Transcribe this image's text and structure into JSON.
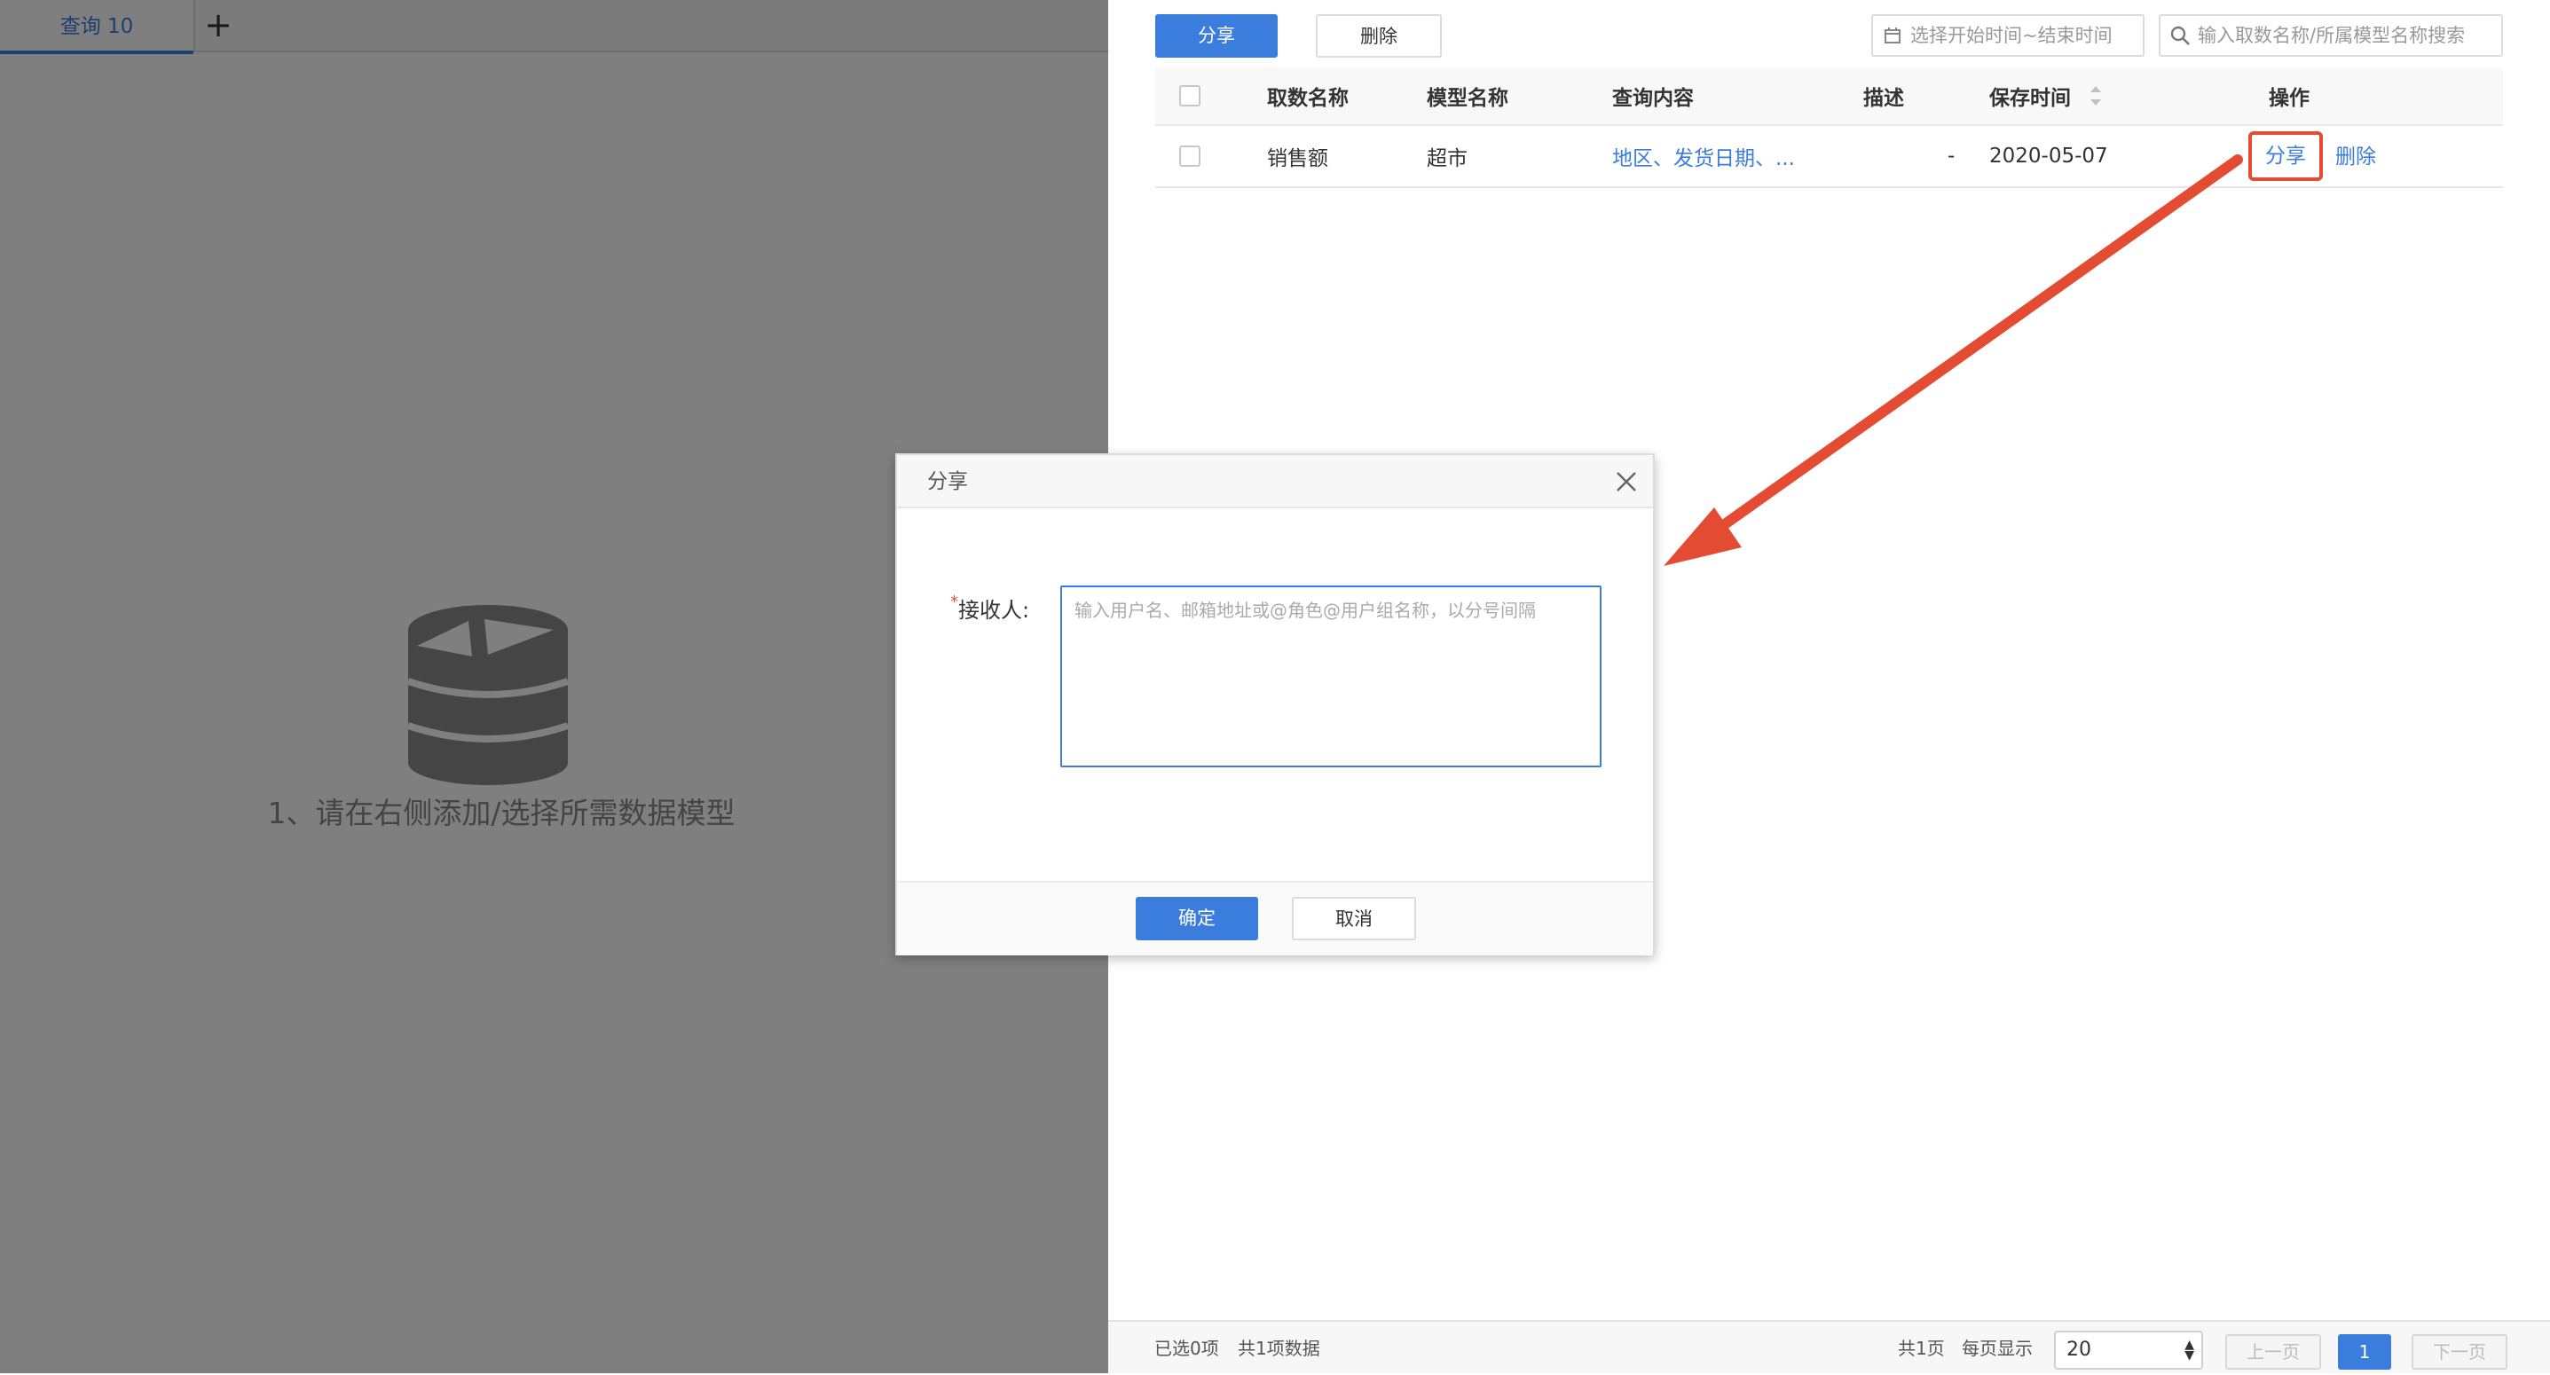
{
  "left": {
    "tab_label": "查询 10",
    "add_tab_symbol": "+",
    "empty_hint": "1、请在右侧添加/选择所需数据模型"
  },
  "toolbar": {
    "share_label": "分享",
    "delete_label": "删除",
    "date_placeholder": "选择开始时间~结束时间",
    "search_placeholder": "输入取数名称/所属模型名称搜索"
  },
  "table": {
    "columns": [
      "取数名称",
      "模型名称",
      "查询内容",
      "描述",
      "保存时间",
      "操作"
    ],
    "rows": [
      {
        "name": "销售额",
        "model": "超市",
        "content": "地区、发货日期、...",
        "desc": "-",
        "saved": "2020-05-07",
        "actions": [
          "分享",
          "删除"
        ]
      }
    ]
  },
  "footer": {
    "selected": "已选0项",
    "total": "共1项数据",
    "pages": "共1页",
    "per_page_label": "每页显示",
    "per_page_value": "20",
    "prev": "上一页",
    "current_page": "1",
    "next": "下一页"
  },
  "dialog": {
    "title": "分享",
    "required_mark": "*",
    "recipient_label": "接收人:",
    "recipient_placeholder": "输入用户名、邮箱地址或@角色@用户组名称，以分号间隔",
    "recipient_value": "",
    "ok_label": "确定",
    "cancel_label": "取消"
  },
  "colors": {
    "primary": "#3b7ddd",
    "annotation": "#e34b32"
  },
  "icons": {
    "empty_state": "database-pie-icon",
    "date": "calendar-icon",
    "search": "search-icon",
    "close": "close-icon",
    "sort": "sort-icon"
  }
}
